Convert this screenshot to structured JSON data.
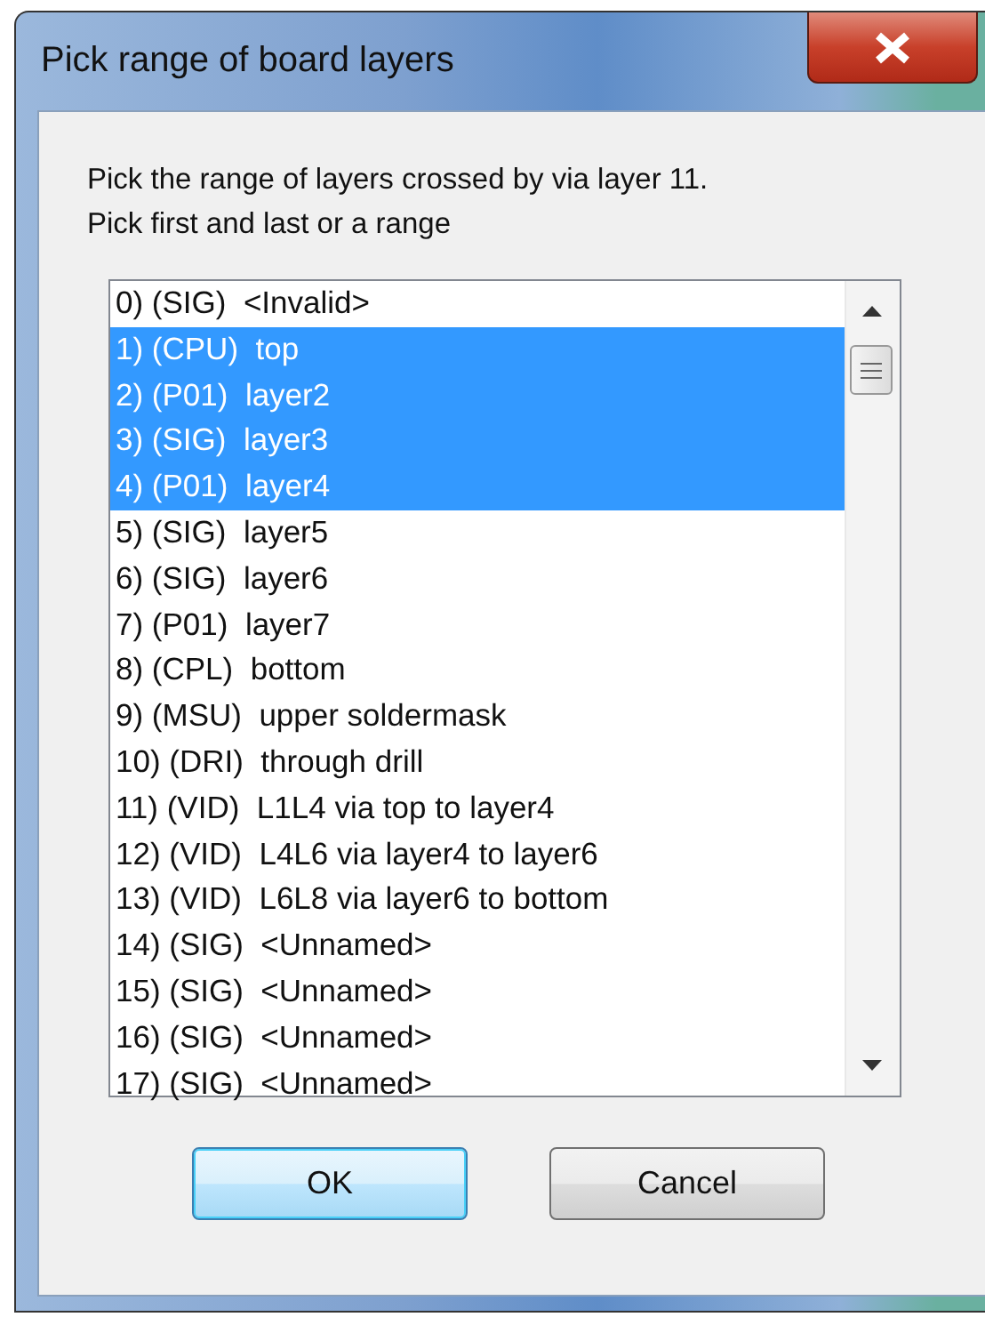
{
  "window": {
    "title": "Pick range of board layers"
  },
  "instructions": [
    "Pick the range of layers crossed by via layer 11.",
    "Pick first and last or a range"
  ],
  "layers": [
    {
      "text": "0) (SIG)  <Invalid>",
      "selected": false
    },
    {
      "text": "1) (CPU)  top",
      "selected": true
    },
    {
      "text": "2) (P01)  layer2",
      "selected": true
    },
    {
      "text": "3) (SIG)  layer3",
      "selected": true
    },
    {
      "text": "4) (P01)  layer4",
      "selected": true
    },
    {
      "text": "5) (SIG)  layer5",
      "selected": false
    },
    {
      "text": "6) (SIG)  layer6",
      "selected": false
    },
    {
      "text": "7) (P01)  layer7",
      "selected": false
    },
    {
      "text": "8) (CPL)  bottom",
      "selected": false
    },
    {
      "text": "9) (MSU)  upper soldermask",
      "selected": false
    },
    {
      "text": "10) (DRI)  through drill",
      "selected": false
    },
    {
      "text": "11) (VID)  L1L4 via top to layer4",
      "selected": false
    },
    {
      "text": "12) (VID)  L4L6 via layer4 to layer6",
      "selected": false
    },
    {
      "text": "13) (VID)  L6L8 via layer6 to bottom",
      "selected": false
    },
    {
      "text": "14) (SIG)  <Unnamed>",
      "selected": false
    },
    {
      "text": "15) (SIG)  <Unnamed>",
      "selected": false
    },
    {
      "text": "16) (SIG)  <Unnamed>",
      "selected": false
    },
    {
      "text": "17) (SIG)  <Unnamed>",
      "selected": false
    }
  ],
  "buttons": [
    {
      "label": "OK",
      "default": true
    },
    {
      "label": "Cancel",
      "default": false
    }
  ]
}
